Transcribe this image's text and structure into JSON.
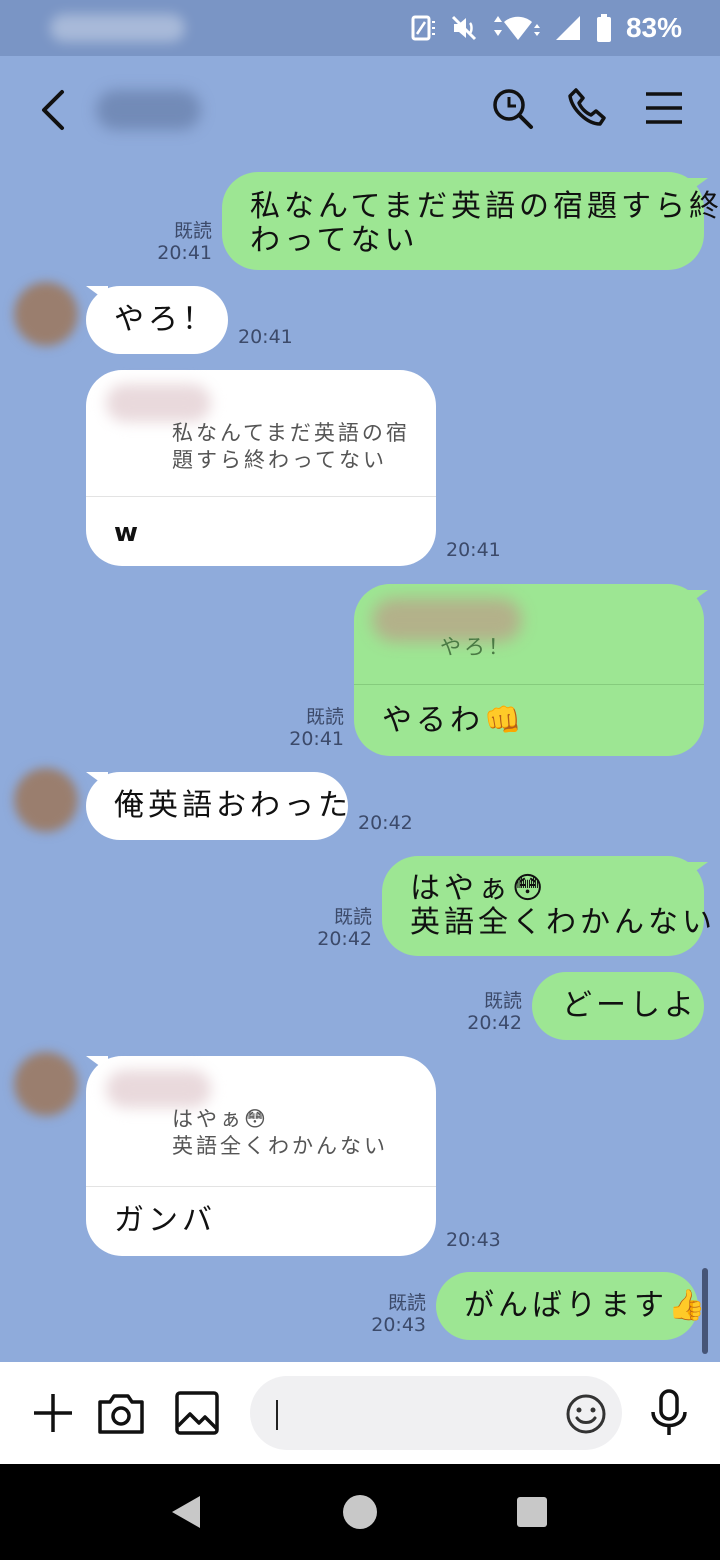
{
  "status_bar": {
    "battery": "83%",
    "icons": [
      "screen-rotate-icon",
      "mute-icon",
      "wifi-icon",
      "signal-icon",
      "battery-icon"
    ]
  },
  "header": {
    "icons": [
      "back-icon",
      "search-history-icon",
      "phone-icon",
      "menu-icon"
    ]
  },
  "messages": [
    {
      "id": "m1",
      "side": "out",
      "lines": [
        "私なんてまだ英語の宿題すら終",
        "わってない"
      ],
      "read": "既読",
      "time": "20:41"
    },
    {
      "id": "m2",
      "side": "in",
      "lines": [
        "やろ！"
      ],
      "time": "20:41"
    },
    {
      "id": "m3",
      "side": "in",
      "quote_lines": [
        "私なんてまだ英語の宿",
        "題すら終わってない"
      ],
      "lines": [
        "w"
      ],
      "time": "20:41"
    },
    {
      "id": "m4",
      "side": "out",
      "quote_lines": [
        "やろ！"
      ],
      "lines": [
        "やるわ👊"
      ],
      "read": "既読",
      "time": "20:41"
    },
    {
      "id": "m5",
      "side": "in",
      "lines": [
        "俺英語おわった"
      ],
      "time": "20:42"
    },
    {
      "id": "m6",
      "side": "out",
      "lines": [
        "はやぁ😳",
        "英語全くわかんない"
      ],
      "read": "既読",
      "time": "20:42"
    },
    {
      "id": "m7",
      "side": "out",
      "lines": [
        "どーしよ"
      ],
      "read": "既読",
      "time": "20:42"
    },
    {
      "id": "m8",
      "side": "in",
      "quote_lines": [
        "はやぁ😳",
        "英語全くわかんない"
      ],
      "lines": [
        "ガンバ"
      ],
      "time": "20:43"
    },
    {
      "id": "m9",
      "side": "out",
      "lines": [
        "がんばります👍"
      ],
      "read": "既読",
      "time": "20:43"
    }
  ],
  "input_bar": {
    "icons": [
      "plus-icon",
      "camera-icon",
      "image-icon",
      "emoji-icon",
      "mic-icon"
    ],
    "text": ""
  },
  "nav_bar": {
    "icons": [
      "back-triangle-icon",
      "home-circle-icon",
      "recents-square-icon"
    ]
  },
  "colors": {
    "chat_background": "#8fabdb",
    "outgoing_bubble": "#9de693",
    "incoming_bubble": "#ffffff"
  }
}
